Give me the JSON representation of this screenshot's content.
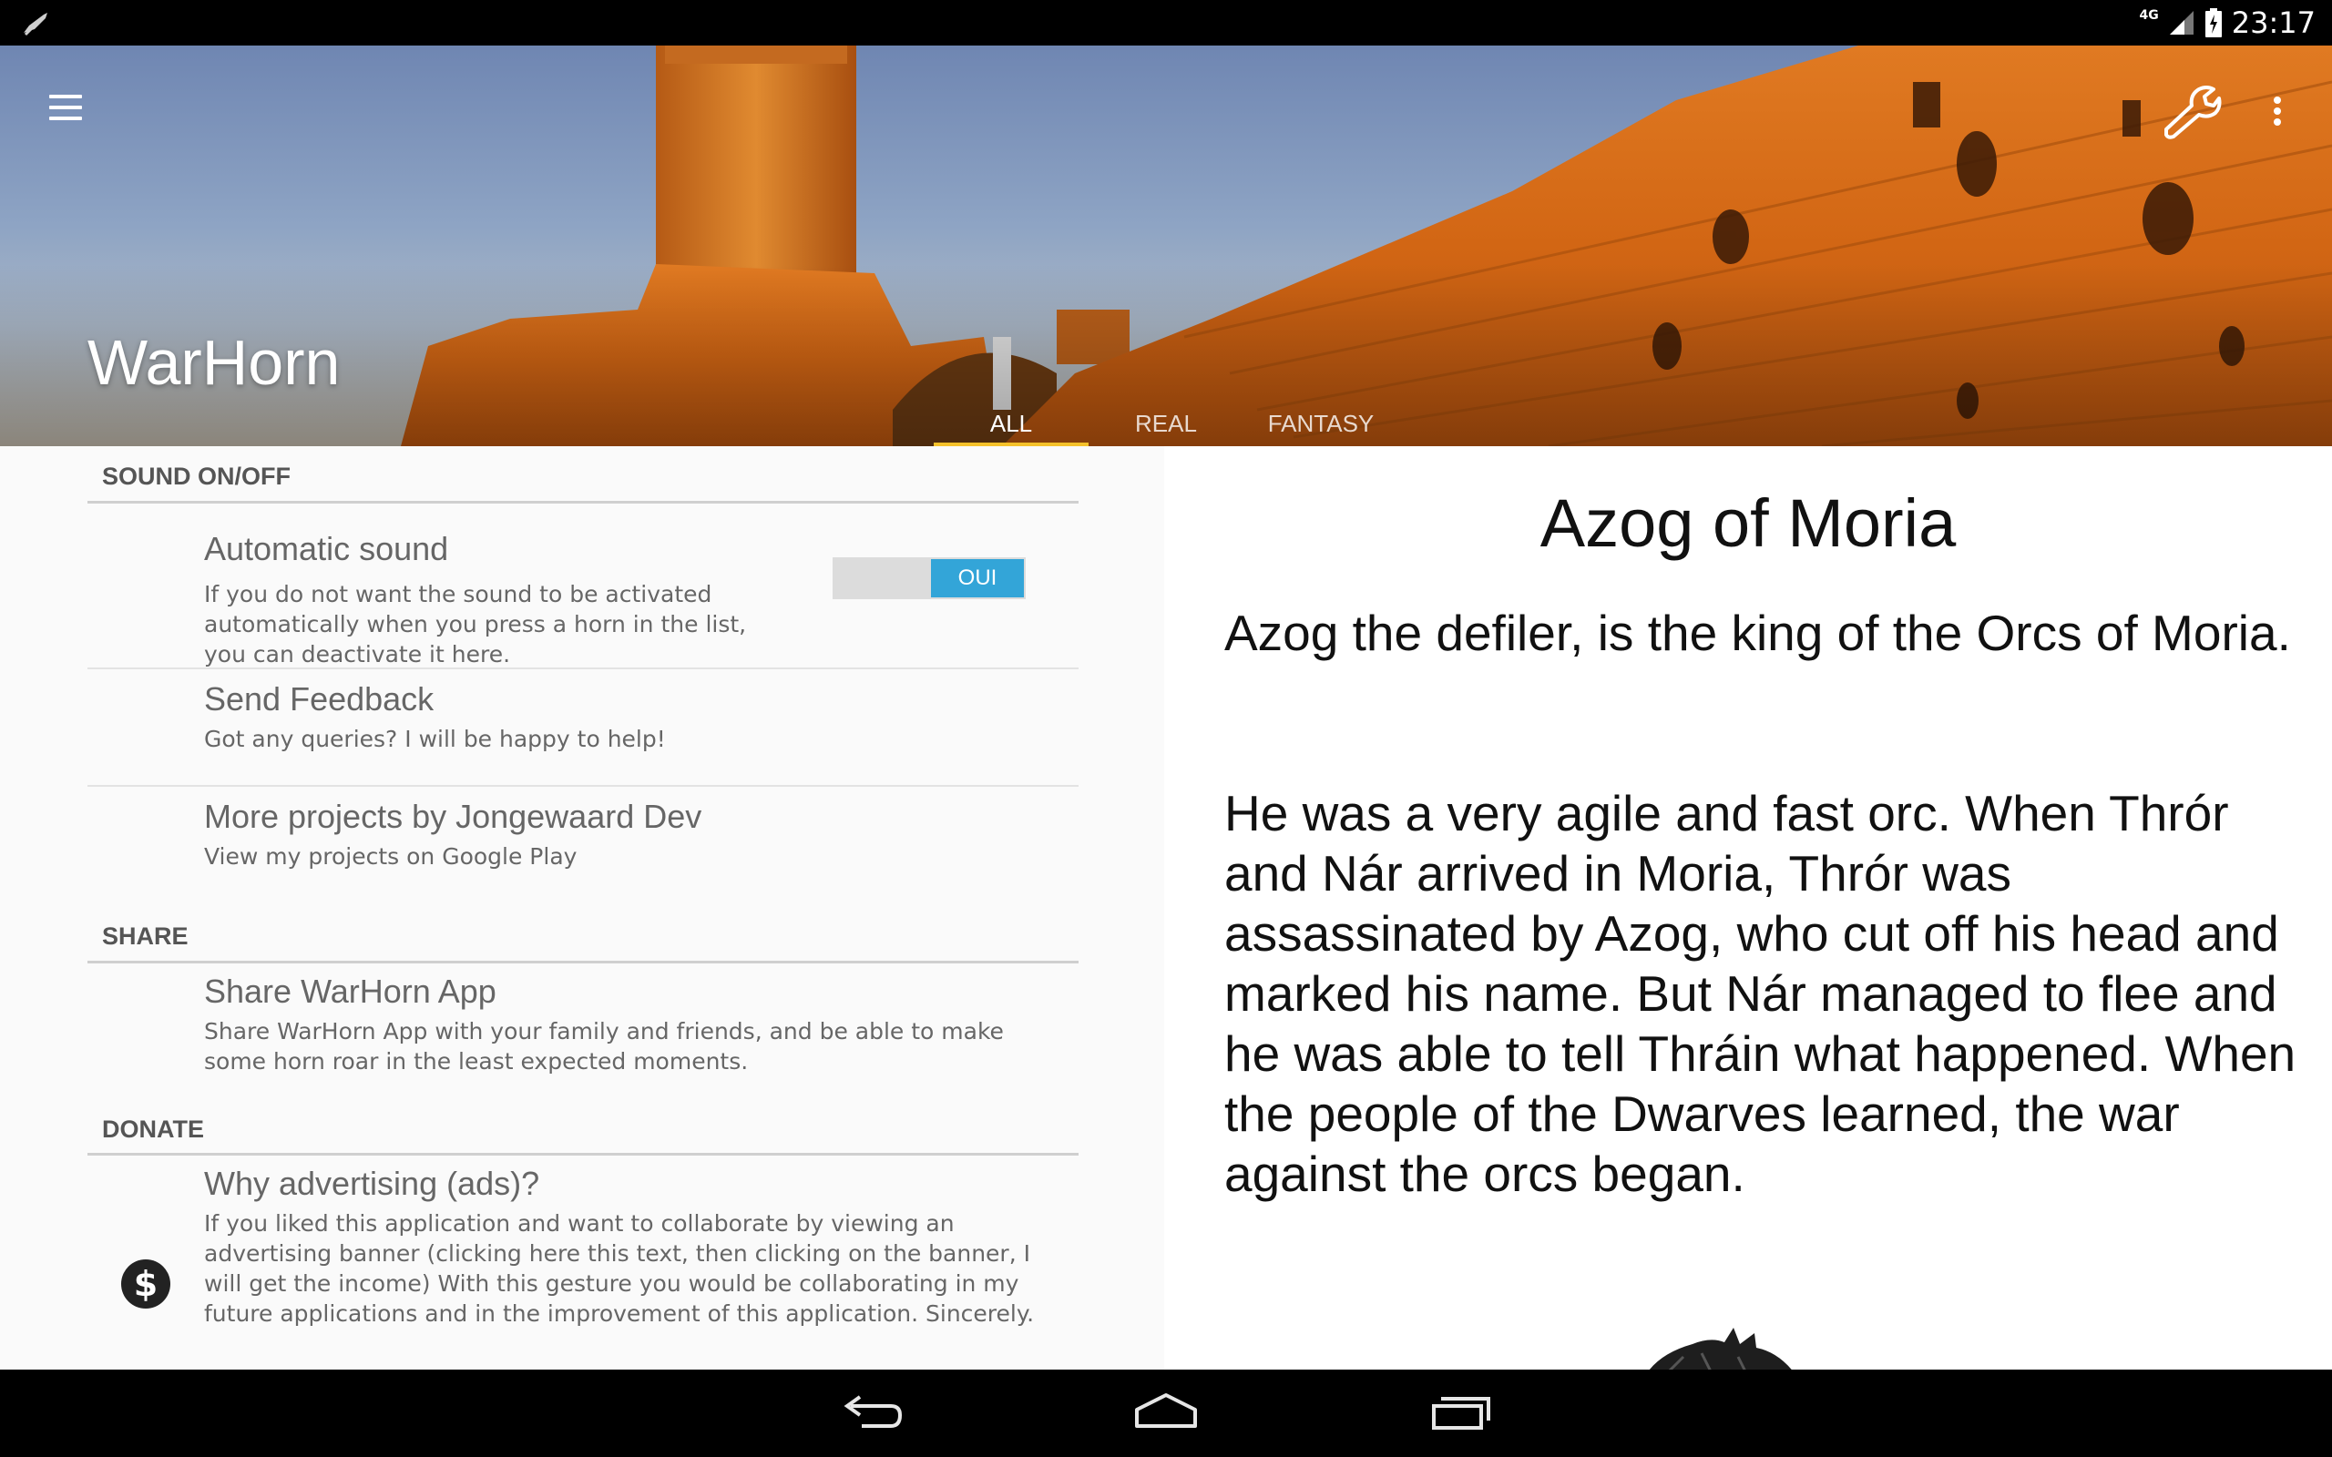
{
  "status_bar": {
    "network": "4G",
    "time": "23:17"
  },
  "header": {
    "app_title": "WarHorn",
    "tabs": [
      {
        "label": "ALL",
        "active": true
      },
      {
        "label": "REAL",
        "active": false
      },
      {
        "label": "FANTASY",
        "active": false
      }
    ],
    "accent_color": "#f5c12a"
  },
  "settings": {
    "sound_category": "SOUND ON/OFF",
    "automatic_sound": {
      "title": "Automatic sound",
      "summary": "If you do not want the sound to be activated automatically when you press a horn in the list, you can deactivate it here.",
      "toggle_label": "OUI",
      "toggle_on": true
    },
    "send_feedback": {
      "title": "Send Feedback",
      "summary": "Got any queries? I will be happy to help!"
    },
    "more_projects": {
      "title": "More projects by Jongewaard Dev",
      "summary": "View my projects on Google Play"
    },
    "share_category": "SHARE",
    "share_app": {
      "title": "Share WarHorn App",
      "summary": "Share WarHorn App with your family and friends, and be able to make some horn roar in the least expected moments."
    },
    "donate_category": "DONATE",
    "why_ads": {
      "title": "Why advertising (ads)?",
      "summary": "If you liked this application and want to collaborate by viewing an advertising banner (clicking here this text, then clicking on the banner, I will get the income) With this gesture you would be collaborating in my future applications and in the improvement of this application. Sincerely."
    },
    "toggle_color": "#33a5d8"
  },
  "detail": {
    "title": "Azog of Moria",
    "paragraph_1": "Azog the defiler, is the king of the Orcs of Moria.",
    "paragraph_2": "He was a very agile and fast orc. When Thrór and Nár arrived in Moria, Thrór was assassinated by Azog, who cut off his head and marked his name. But Nár managed to flee and he was able to tell Thráin what happened. When the people of the Dwarves learned, the war against the orcs began."
  },
  "nav_bar": {
    "icons": [
      "back-icon",
      "home-icon",
      "recents-icon"
    ]
  }
}
